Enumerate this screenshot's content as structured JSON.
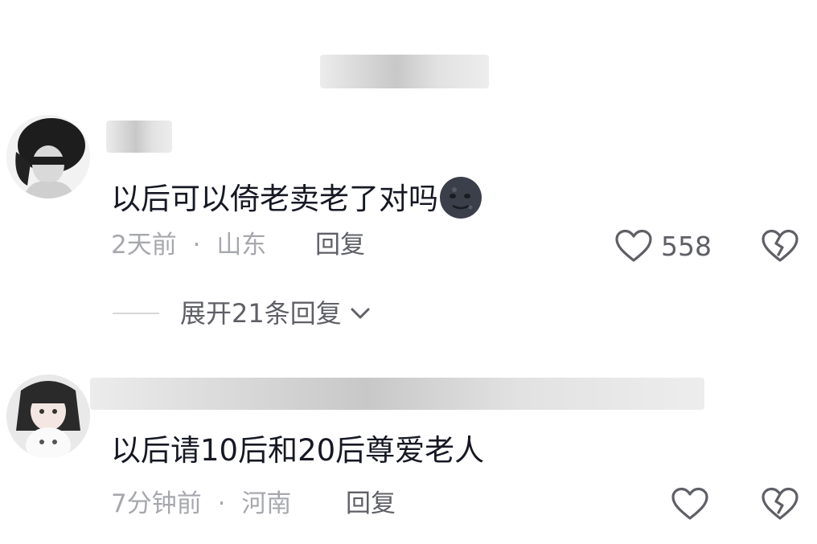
{
  "comments": [
    {
      "text": "以后可以倚老卖老了对吗",
      "emoji": "🌚",
      "time": "2天前",
      "separator": "·",
      "location": "山东",
      "reply_label": "回复",
      "like_count": "558",
      "expand_replies_label": "展开21条回复"
    },
    {
      "text": "以后请10后和20后尊爱老人",
      "time": "7分钟前",
      "separator": "·",
      "location": "河南",
      "reply_label": "回复"
    }
  ],
  "colors": {
    "text_primary": "#161823",
    "text_secondary": "#a7a8ad",
    "text_action": "#5f6066"
  },
  "icons": [
    "heart-outline-icon",
    "broken-heart-icon",
    "chevron-down-icon",
    "avatar-image"
  ]
}
